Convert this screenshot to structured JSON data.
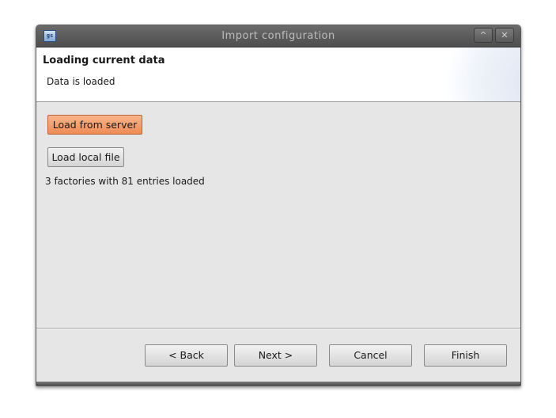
{
  "window": {
    "title": "Import configuration",
    "app_icon_text": "gs"
  },
  "titlebar_buttons": {
    "maximize": "^",
    "close": "✕"
  },
  "banner": {
    "title": "Loading current data",
    "subtitle": "Data is loaded"
  },
  "content": {
    "load_server_label": "Load from server",
    "load_local_label": "Load local file",
    "status": "3 factories with 81 entries loaded"
  },
  "footer": {
    "back_label": "< Back",
    "next_label": "Next >",
    "cancel_label": "Cancel",
    "finish_label": "Finish"
  },
  "colors": {
    "primary_button": "#ef8b55",
    "titlebar": "#5a5a5a",
    "dialog_background": "#e6e6e6"
  }
}
